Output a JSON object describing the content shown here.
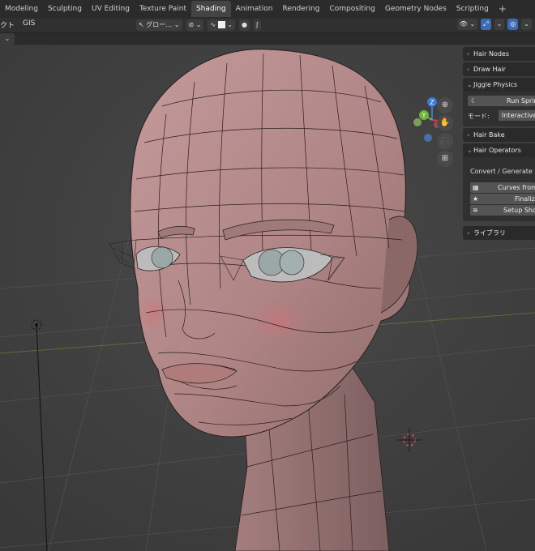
{
  "workspace_tabs": [
    {
      "label": "Modeling",
      "active": false
    },
    {
      "label": "Sculpting",
      "active": false
    },
    {
      "label": "UV Editing",
      "active": false
    },
    {
      "label": "Texture Paint",
      "active": false
    },
    {
      "label": "Shading",
      "active": true
    },
    {
      "label": "Animation",
      "active": false
    },
    {
      "label": "Rendering",
      "active": false
    },
    {
      "label": "Compositing",
      "active": false
    },
    {
      "label": "Geometry Nodes",
      "active": false
    },
    {
      "label": "Scripting",
      "active": false
    }
  ],
  "add_workspace": "+",
  "header": {
    "left_menu_1": "クト",
    "left_menu_2": "GIS",
    "transform_orientation": "グロー…",
    "header_dropdown_glyph": "⌄"
  },
  "colors": {
    "accent_blue": "#3b6ab7",
    "axis_x": "#e03b48",
    "axis_y": "#6fb43a",
    "axis_z": "#3d77d6",
    "mesh_skin": "#b58b8b",
    "mesh_wire": "#2a1e1e"
  },
  "gizmo": {
    "x_label": "X",
    "y_label": "Y",
    "z_label": "Z"
  },
  "nav_buttons": [
    "zoom-icon",
    "hand-icon",
    "camera-icon",
    "grid-icon"
  ],
  "n_panel": {
    "hair_nodes": "Hair Nodes",
    "draw_hair": "Draw Hair",
    "jiggle_physics": "Jiggle Physics",
    "run_spring": "Run Spring",
    "mode_label": "モード:",
    "mode_value": "Interactive",
    "hair_bake": "Hair Bake",
    "hair_operators": "Hair Operators",
    "convert_generate": "Convert / Generate hai",
    "curves_from": "Curves from",
    "finalize": "Finalize",
    "setup_short": "Setup Shor",
    "library": "ライブラリ"
  }
}
